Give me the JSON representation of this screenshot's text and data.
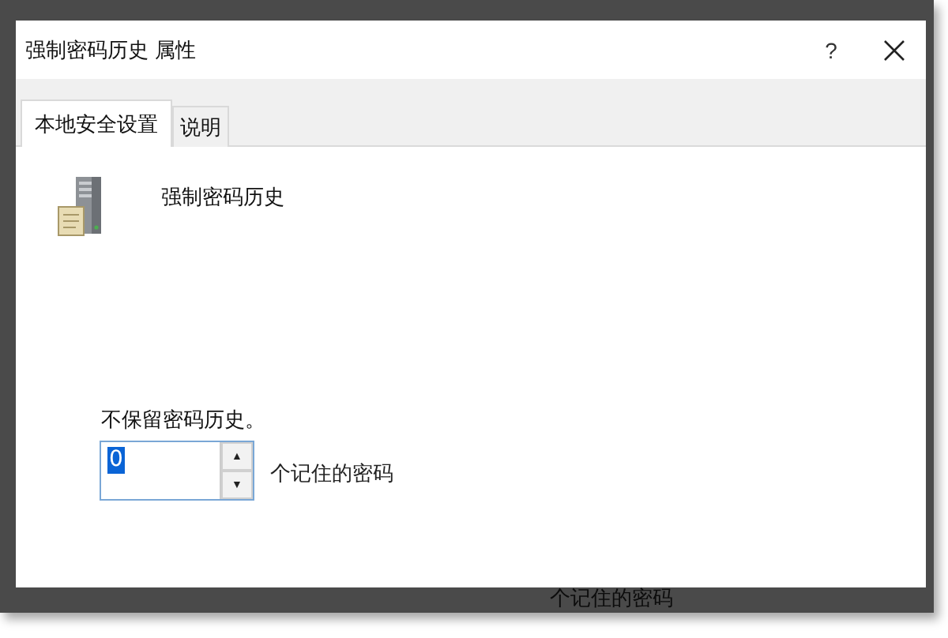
{
  "window": {
    "title": "强制密码历史 属性",
    "help_button": "?"
  },
  "tabs": [
    {
      "label": "本地安全设置",
      "selected": true
    },
    {
      "label": "说明",
      "selected": false
    }
  ],
  "policy": {
    "name": "强制密码历史",
    "description": "不保留密码历史。",
    "spinner": {
      "value": "0",
      "value_selected": true,
      "up": "▲",
      "down": "▼"
    },
    "unit": "个记住的密码"
  },
  "background": {
    "unit": "个记住的密码"
  }
}
